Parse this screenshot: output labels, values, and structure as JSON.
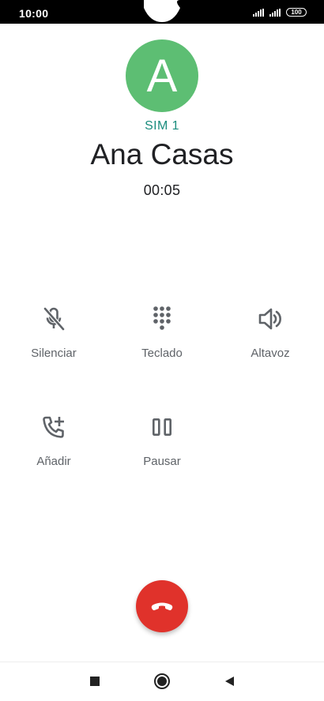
{
  "status_bar": {
    "time": "10:00",
    "battery": "100",
    "icons": [
      "signal-icon",
      "signal-icon",
      "battery-icon"
    ]
  },
  "caller": {
    "avatar_letter": "A",
    "sim": "SIM 1",
    "name": "Ana Casas",
    "duration": "00:05"
  },
  "actions": [
    {
      "icon": "mic-off-icon",
      "label": "Silenciar"
    },
    {
      "icon": "dialpad-icon",
      "label": "Teclado"
    },
    {
      "icon": "speaker-icon",
      "label": "Altavoz"
    },
    {
      "icon": "add-call-icon",
      "label": "Añadir"
    },
    {
      "icon": "pause-icon",
      "label": "Pausar"
    }
  ],
  "end_call": {
    "icon": "end-call-icon"
  },
  "nav": {
    "icons": [
      "recents-square-icon",
      "home-circle-icon",
      "back-triangle-icon"
    ]
  },
  "colors": {
    "avatar": "#5dbe73",
    "sim": "#1a8c7d",
    "end_call": "#e0322b",
    "icon": "#5f6368"
  }
}
